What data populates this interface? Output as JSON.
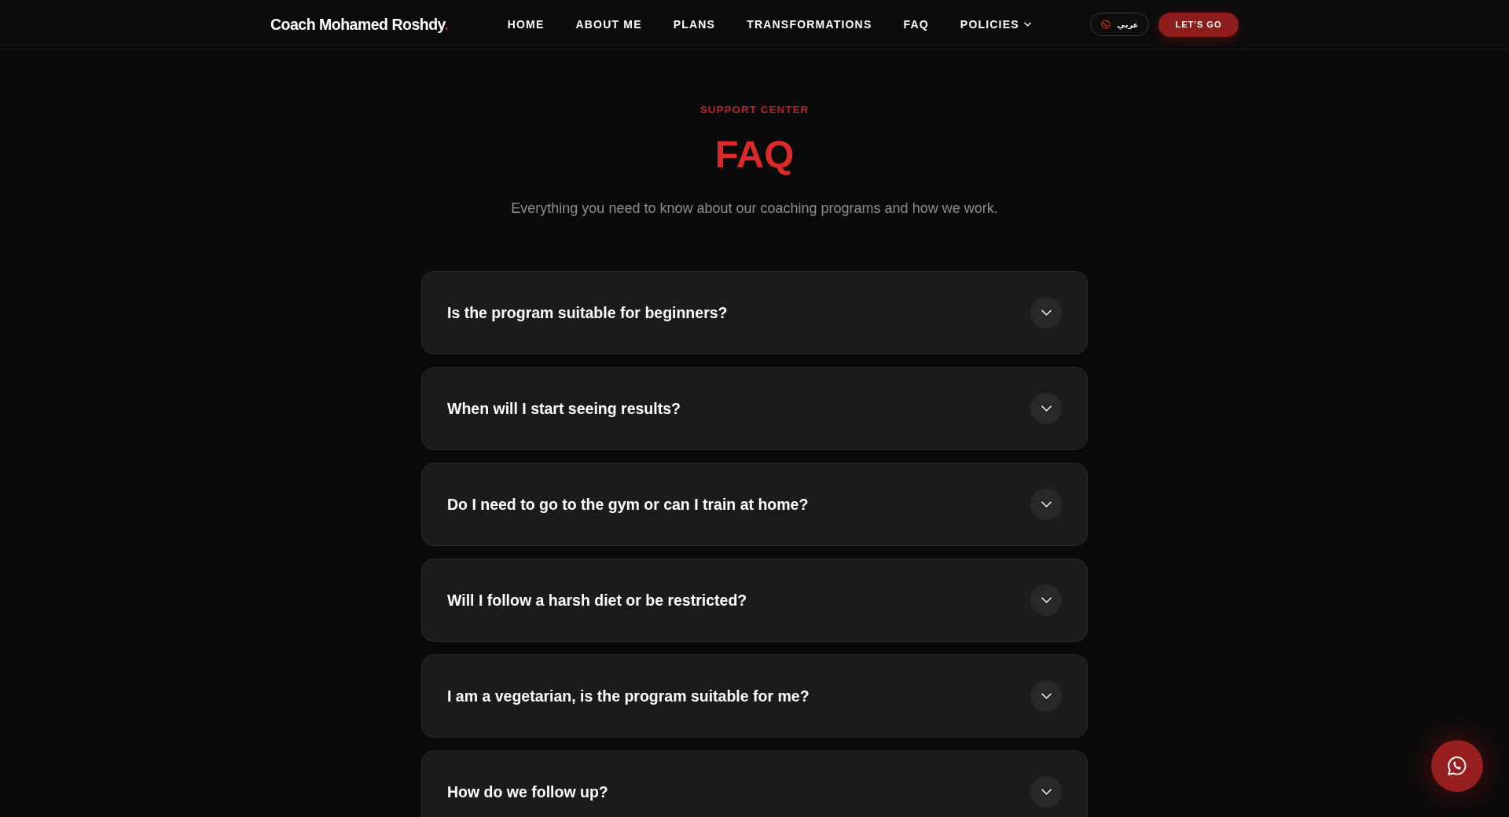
{
  "header": {
    "logo": {
      "text": "Coach Mohamed Roshdy",
      "accent": "."
    },
    "nav": [
      {
        "label": "HOME",
        "kind": "link"
      },
      {
        "label": "ABOUT ME",
        "kind": "link"
      },
      {
        "label": "PLANS",
        "kind": "link"
      },
      {
        "label": "TRANSFORMATIONS",
        "kind": "link"
      },
      {
        "label": "FAQ",
        "kind": "link"
      },
      {
        "label": "POLICIES",
        "kind": "dropdown"
      }
    ],
    "language_button": {
      "label": "عربي"
    },
    "cta_button": {
      "label": "LET'S GO"
    }
  },
  "hero": {
    "eyebrow": "SUPPORT CENTER",
    "title": "FAQ",
    "subtitle": "Everything you need to know about our coaching programs and how we work."
  },
  "faq": [
    {
      "question": "Is the program suitable for beginners?",
      "expanded": false
    },
    {
      "question": "When will I start seeing results?",
      "expanded": false
    },
    {
      "question": "Do I need to go to the gym or can I train at home?",
      "expanded": false
    },
    {
      "question": "Will I follow a harsh diet or be restricted?",
      "expanded": false
    },
    {
      "question": "I am a vegetarian, is the program suitable for me?",
      "expanded": false
    },
    {
      "question": "How do we follow up?",
      "expanded": false
    }
  ]
}
